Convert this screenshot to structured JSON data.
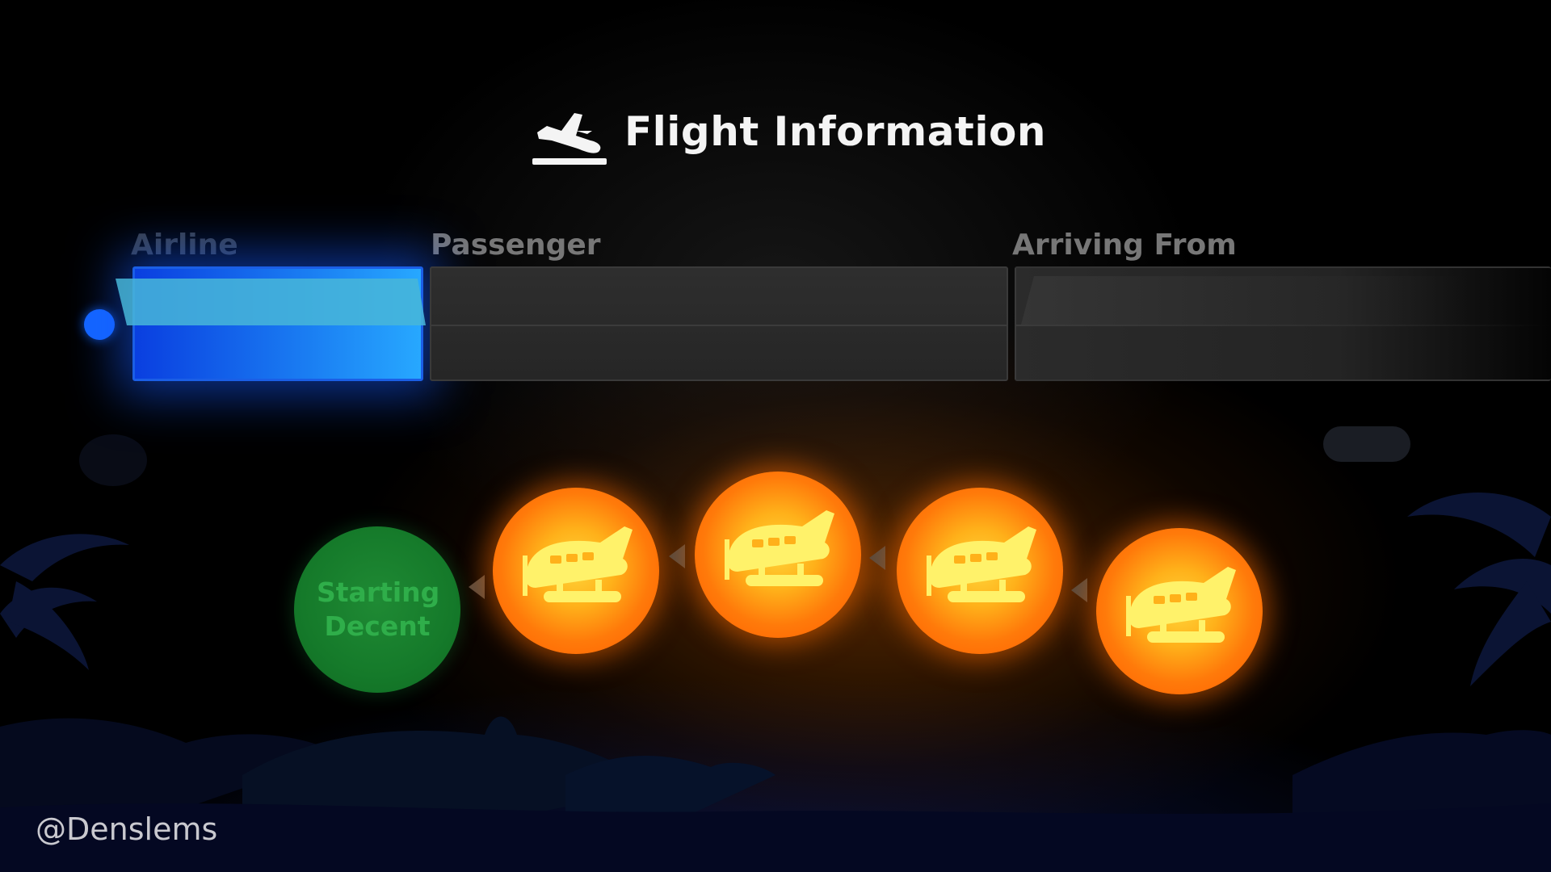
{
  "header": {
    "title": "Flight Information",
    "icon": "plane-landing-icon"
  },
  "board": {
    "columns": [
      {
        "label": "Airline",
        "value": ""
      },
      {
        "label": "Passenger",
        "value": ""
      },
      {
        "label": "Arriving From",
        "value": ""
      }
    ],
    "active_column": "Airline",
    "colors": {
      "active_cell": "#1a7df2",
      "indicator": "#1466ff",
      "inactive_cell": "#2b2b2b"
    }
  },
  "steps": {
    "start_label": "Starting Decent",
    "items": [
      {
        "icon": "seaplane-icon",
        "status": "pending"
      },
      {
        "icon": "seaplane-icon",
        "status": "pending"
      },
      {
        "icon": "seaplane-icon",
        "status": "pending"
      },
      {
        "icon": "seaplane-icon",
        "status": "pending"
      }
    ],
    "colors": {
      "start": "#157a2a",
      "pending": "#ff7a0a"
    }
  },
  "footer": {
    "credit": "@Denslems"
  }
}
